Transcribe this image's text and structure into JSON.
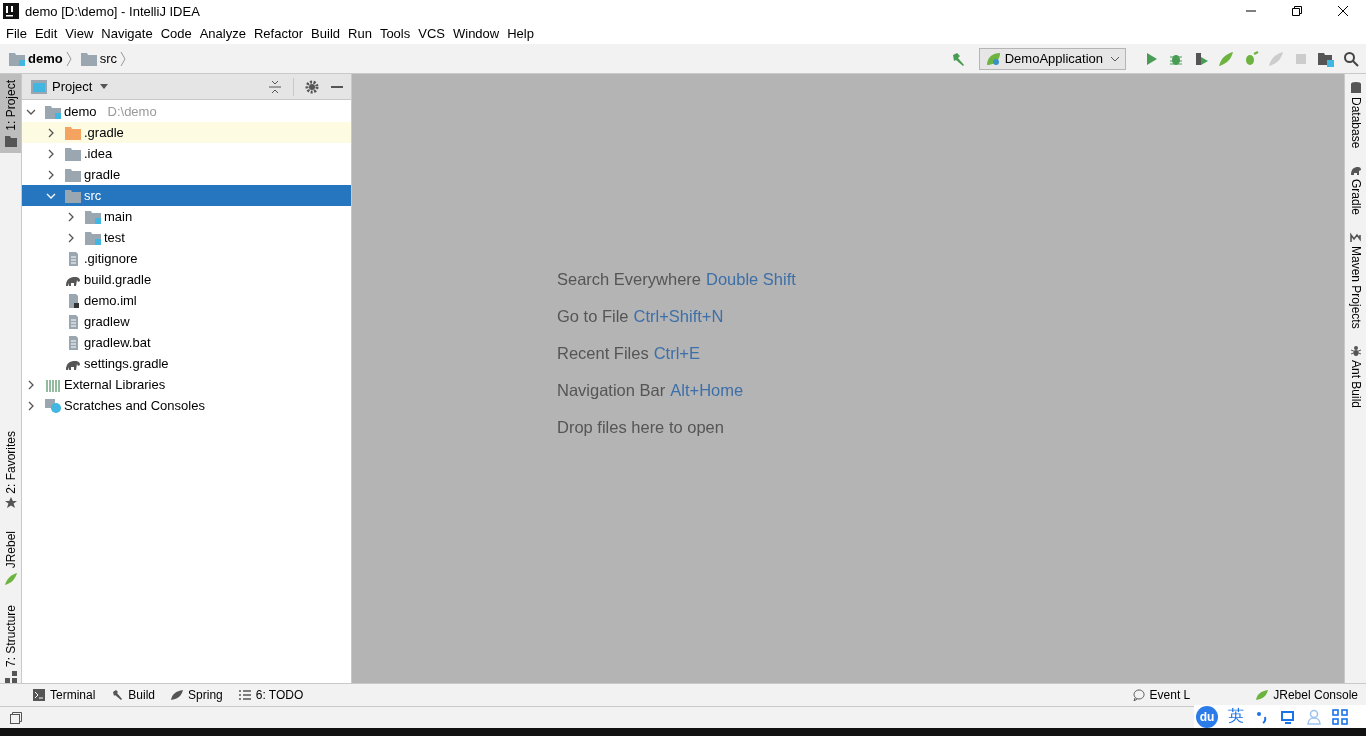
{
  "window": {
    "title": "demo [D:\\demo] - IntelliJ IDEA"
  },
  "menu": [
    "File",
    "Edit",
    "View",
    "Navigate",
    "Code",
    "Analyze",
    "Refactor",
    "Build",
    "Run",
    "Tools",
    "VCS",
    "Window",
    "Help"
  ],
  "breadcrumbs": [
    {
      "label": "demo",
      "kind": "module"
    },
    {
      "label": "src",
      "kind": "folder"
    }
  ],
  "run_config": {
    "label": "DemoApplication"
  },
  "left_stripe": [
    {
      "label": "1: Project",
      "selected": true,
      "kind": "project"
    },
    {
      "label": "2: Favorites",
      "selected": false,
      "kind": "star"
    },
    {
      "label": "JRebel",
      "selected": false,
      "kind": "jrebel"
    },
    {
      "label": "7: Structure",
      "selected": false,
      "kind": "structure"
    }
  ],
  "right_stripe": [
    {
      "label": "Database",
      "kind": "database"
    },
    {
      "label": "Gradle",
      "kind": "gradle"
    },
    {
      "label": "Maven Projects",
      "kind": "maven"
    },
    {
      "label": "Ant Build",
      "kind": "ant"
    }
  ],
  "project_panel": {
    "title": "Project"
  },
  "tree": [
    {
      "label": "demo",
      "hint": "D:\\demo",
      "kind": "module",
      "expanded": true,
      "selected": false,
      "highlighted": false,
      "children": [
        {
          "label": ".gradle",
          "kind": "excluded-folder",
          "expanded": false,
          "selected": false,
          "highlighted": true
        },
        {
          "label": ".idea",
          "kind": "folder",
          "expanded": false,
          "selected": false,
          "highlighted": false
        },
        {
          "label": "gradle",
          "kind": "folder",
          "expanded": false,
          "selected": false,
          "highlighted": false
        },
        {
          "label": "src",
          "kind": "folder",
          "expanded": true,
          "selected": true,
          "highlighted": false,
          "children": [
            {
              "label": "main",
              "kind": "module",
              "expanded": false,
              "selected": false,
              "highlighted": false
            },
            {
              "label": "test",
              "kind": "module",
              "expanded": false,
              "selected": false,
              "highlighted": false
            }
          ]
        },
        {
          "label": ".gitignore",
          "kind": "file",
          "selected": false,
          "highlighted": false
        },
        {
          "label": "build.gradle",
          "kind": "gradle",
          "selected": false,
          "highlighted": false
        },
        {
          "label": "demo.iml",
          "kind": "iml",
          "selected": false,
          "highlighted": false
        },
        {
          "label": "gradlew",
          "kind": "file",
          "selected": false,
          "highlighted": false
        },
        {
          "label": "gradlew.bat",
          "kind": "file",
          "selected": false,
          "highlighted": false
        },
        {
          "label": "settings.gradle",
          "kind": "gradle",
          "selected": false,
          "highlighted": false
        }
      ]
    },
    {
      "label": "External Libraries",
      "kind": "libraries",
      "expanded": false,
      "selected": false,
      "highlighted": false
    },
    {
      "label": "Scratches and Consoles",
      "kind": "scratches",
      "expanded": false,
      "selected": false,
      "highlighted": false
    }
  ],
  "editor_hints": [
    {
      "text": "Search Everywhere",
      "shortcut": "Double Shift"
    },
    {
      "text": "Go to File",
      "shortcut": "Ctrl+Shift+N"
    },
    {
      "text": "Recent Files",
      "shortcut": "Ctrl+E"
    },
    {
      "text": "Navigation Bar",
      "shortcut": "Alt+Home"
    },
    {
      "text": "Drop files here to open"
    }
  ],
  "bottom_tools": [
    {
      "label": "Terminal",
      "kind": "terminal"
    },
    {
      "label": "Build",
      "kind": "build"
    },
    {
      "label": "Spring",
      "kind": "spring"
    },
    {
      "label": "6: TODO",
      "kind": "todo"
    }
  ],
  "bottom_right_tools": [
    {
      "label": "Event L",
      "kind": "event"
    },
    {
      "label": "JRebel Console",
      "kind": "jrebel"
    }
  ],
  "ime": {
    "logo": "du",
    "mode": "英"
  }
}
